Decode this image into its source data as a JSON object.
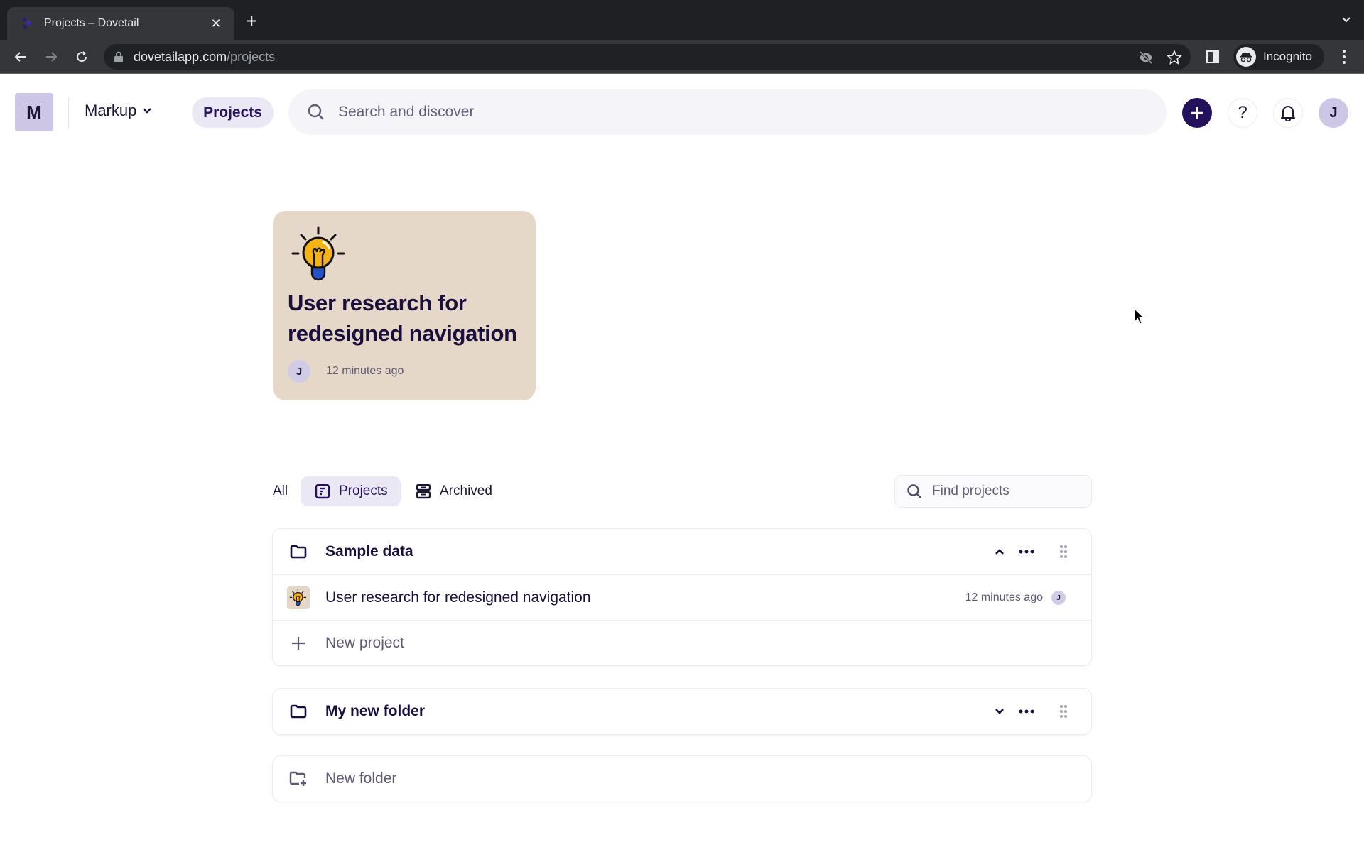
{
  "browser": {
    "tab_title": "Projects – Dovetail",
    "url_host": "dovetailapp.com",
    "url_path": "/projects",
    "profile_label": "Incognito",
    "icons": [
      "back-icon",
      "forward-icon",
      "reload-icon",
      "lock-icon",
      "eye-off-icon",
      "star-icon",
      "side-panel-icon",
      "incognito-icon",
      "more-vert-icon",
      "chevron-down-icon"
    ]
  },
  "header": {
    "workspace_initial": "M",
    "workspace_name": "Markup",
    "nav_active": "Projects",
    "search_placeholder": "Search and discover",
    "help_label": "?",
    "user_initial": "J",
    "accent_color": "#24115c"
  },
  "recent": {
    "title": "User research for redesigned navigation",
    "owner_initial": "J",
    "updated": "12 minutes ago",
    "card_color": "#e6d8c8"
  },
  "filters": {
    "all": "All",
    "projects": "Projects",
    "archived": "Archived",
    "active": "Projects",
    "find_placeholder": "Find projects"
  },
  "folders": [
    {
      "name": "Sample data",
      "expanded": true,
      "projects": [
        {
          "title": "User research for redesigned navigation",
          "updated": "12 minutes ago",
          "owner_initial": "J"
        }
      ],
      "new_project_label": "New project"
    },
    {
      "name": "My new folder",
      "expanded": false,
      "projects": []
    }
  ],
  "new_folder_label": "New folder"
}
